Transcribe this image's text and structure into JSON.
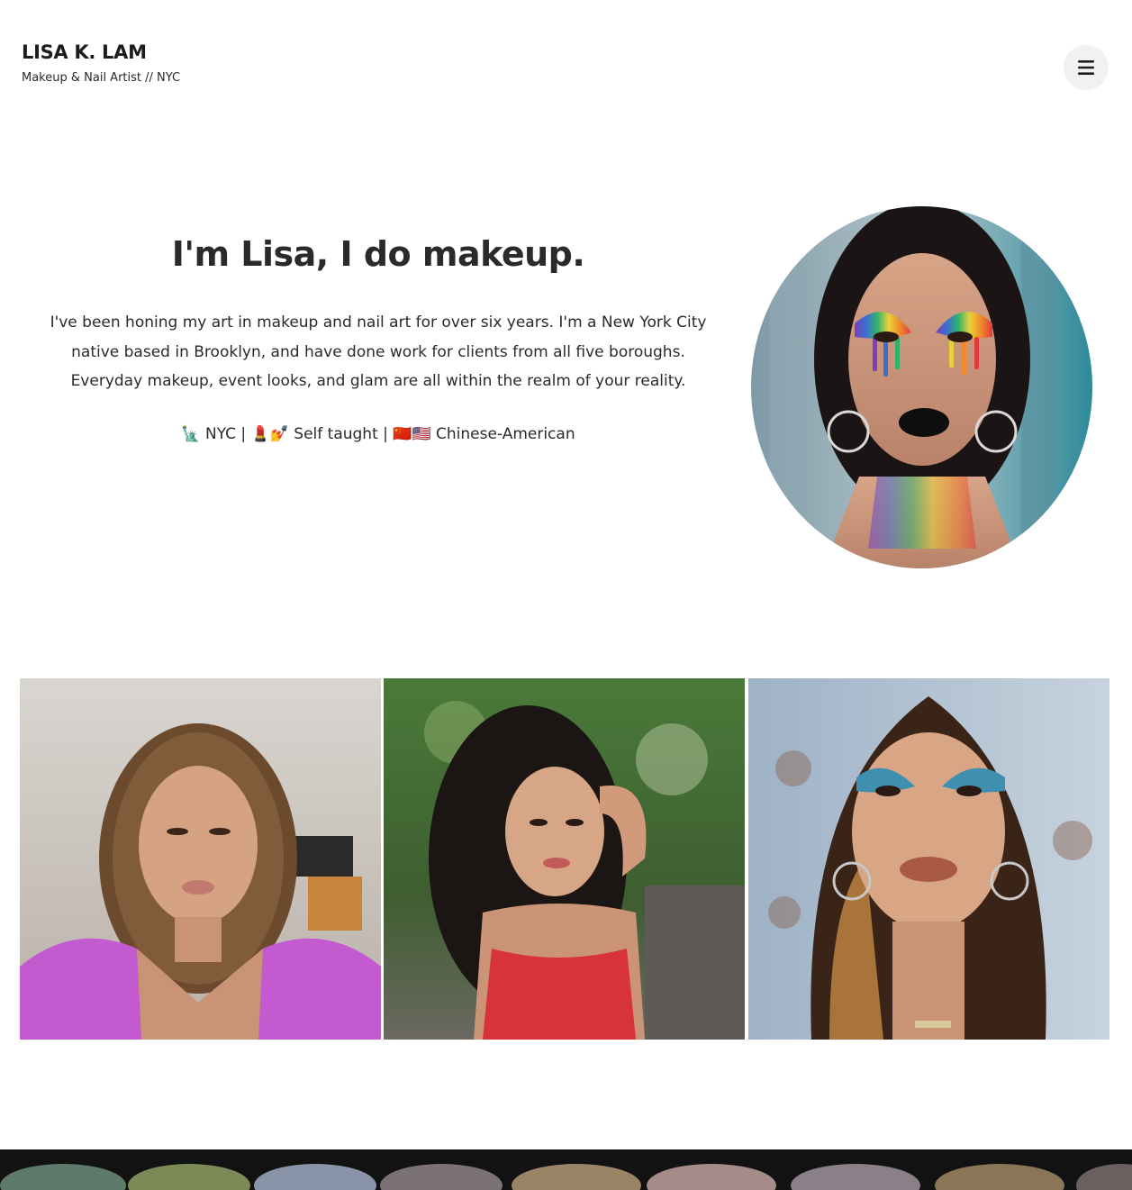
{
  "header": {
    "brand_title": "LISA K. LAM",
    "brand_tagline": "Makeup & Nail Artist // NYC",
    "menu_icon": "hamburger-menu-icon"
  },
  "intro": {
    "heading": "I'm Lisa, I do makeup.",
    "body": "I've been honing my art in makeup and nail art for over six years. I'm a New York City native based in Brooklyn, and have done work for clients from all five boroughs. Everyday makeup, event looks, and glam are all within the realm of your reality.",
    "tagline": "🗽 NYC | 💄💅 Self taught | 🇨🇳🇺🇸 Chinese-American"
  },
  "colors": {
    "text": "#222222",
    "menu_button_bg": "#f1f1f1",
    "background": "#ffffff"
  }
}
